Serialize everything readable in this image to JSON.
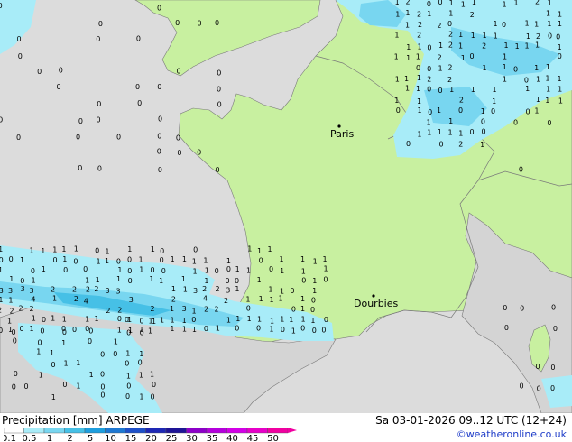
{
  "map": {
    "colors": {
      "land": "#c8f0a0",
      "sea": "#dcdcdc",
      "foreign_land": "#d4d4d4",
      "border": "#7a7a7a",
      "rain_light": "#a8ecf8",
      "rain_moderate": "#78d6f0"
    },
    "cities": [
      {
        "name": "Paris"
      },
      {
        "name": "Dourbies"
      }
    ],
    "precip_labels": [
      "0",
      "1",
      "2",
      "3",
      "4"
    ]
  },
  "footer": {
    "legend_title": "Precipitation [mm]  ARPEGE",
    "valid_time": "Sa 03-01-2026 09..12 UTC (12+24)",
    "credit": "©weatheronline.co.uk",
    "scale": {
      "ticks": [
        "0.1",
        "0.5",
        "1",
        "2",
        "5",
        "10",
        "15",
        "20",
        "25",
        "30",
        "35",
        "40",
        "45",
        "50"
      ],
      "colors": [
        "#ffffff",
        "#a8ecf8",
        "#78d6f0",
        "#46c0e6",
        "#1e9ede",
        "#1e78d2",
        "#1e50c8",
        "#1e28b4",
        "#1e1496",
        "#8c00c8",
        "#b400dc",
        "#d200e6",
        "#e600c8",
        "#f000a0"
      ]
    }
  }
}
